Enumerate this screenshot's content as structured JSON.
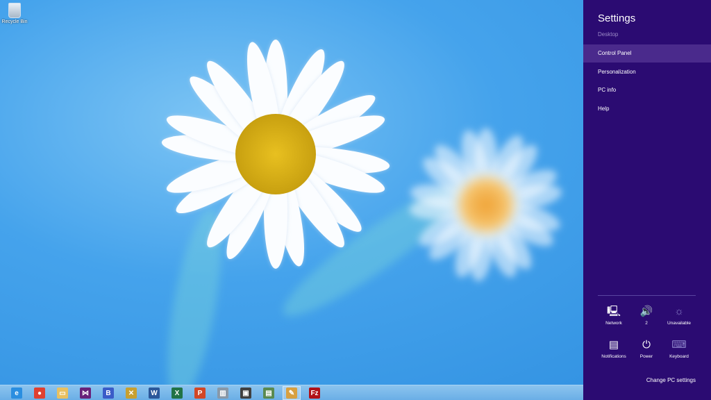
{
  "desktop": {
    "recycle_bin_label": "Recycle Bin"
  },
  "taskbar": {
    "apps": [
      {
        "name": "internet-explorer",
        "glyph": "e",
        "color": "#2a8ee0"
      },
      {
        "name": "chrome",
        "glyph": "●",
        "color": "#e04030"
      },
      {
        "name": "file-explorer",
        "glyph": "▭",
        "color": "#e8c060"
      },
      {
        "name": "visual-studio",
        "glyph": "⋈",
        "color": "#68217a"
      },
      {
        "name": "blend",
        "glyph": "B",
        "color": "#3a5cc8"
      },
      {
        "name": "tools",
        "glyph": "✕",
        "color": "#c8a030"
      },
      {
        "name": "word",
        "glyph": "W",
        "color": "#2b579a"
      },
      {
        "name": "excel",
        "glyph": "X",
        "color": "#217346"
      },
      {
        "name": "powerpoint",
        "glyph": "P",
        "color": "#d24726"
      },
      {
        "name": "server-app",
        "glyph": "▥",
        "color": "#8898a8"
      },
      {
        "name": "virtual-machines",
        "glyph": "▣",
        "color": "#404040"
      },
      {
        "name": "notepad-app",
        "glyph": "▤",
        "color": "#5a8a50"
      },
      {
        "name": "paint-app",
        "glyph": "✎",
        "color": "#d8a040"
      },
      {
        "name": "filezilla",
        "glyph": "Fz",
        "color": "#b01018"
      }
    ]
  },
  "settings": {
    "title": "Settings",
    "context": "Desktop",
    "menu": [
      "Control Panel",
      "Personalization",
      "PC info",
      "Help"
    ],
    "quick": [
      {
        "label": "Network",
        "icon": "network-icon",
        "glyph": "🖳"
      },
      {
        "label": "2",
        "icon": "volume-icon",
        "glyph": "🔊"
      },
      {
        "label": "Unavailable",
        "icon": "brightness-icon",
        "glyph": "☼"
      },
      {
        "label": "Notifications",
        "icon": "notifications-icon",
        "glyph": "▤"
      },
      {
        "label": "Power",
        "icon": "power-icon",
        "glyph": "⏻"
      },
      {
        "label": "Keyboard",
        "icon": "keyboard-icon",
        "glyph": "⌨"
      }
    ],
    "change_pc_settings": "Change PC settings"
  }
}
